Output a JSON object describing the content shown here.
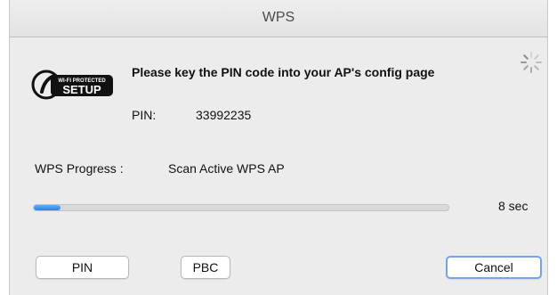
{
  "window": {
    "title": "WPS"
  },
  "logo": {
    "icon": "wifi-protected-setup-logo",
    "top_text": "WI-FI PROTECTED",
    "bottom_text": "SETUP"
  },
  "message": "Please key the PIN code into your AP's config page",
  "spinner": {
    "icon": "loading-spinner-icon"
  },
  "pin": {
    "label": "PIN:",
    "value": "33992235"
  },
  "progress": {
    "label": "WPS Progress :",
    "status": "Scan Active WPS AP",
    "fraction": 0.065,
    "remaining": "8 sec",
    "fill_color": "#2a82e8"
  },
  "buttons": {
    "pin": "PIN",
    "pbc": "PBC",
    "cancel": "Cancel",
    "focus_color": "#73a4ea"
  }
}
